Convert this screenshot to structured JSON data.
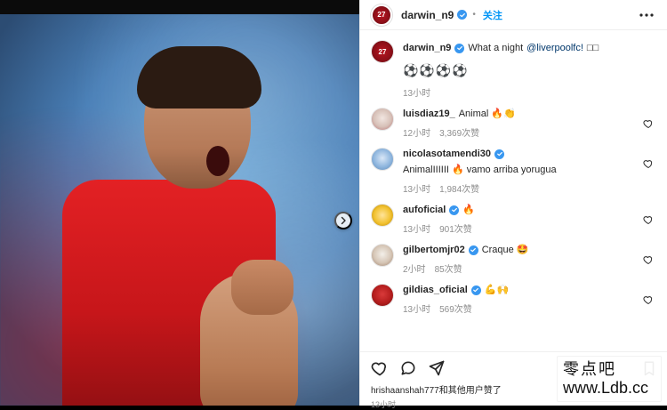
{
  "header": {
    "username": "darwin_n9",
    "follow_label": "关注"
  },
  "caption": {
    "username": "darwin_n9",
    "text_prefix": "What a night",
    "mention": "@liverpoolfc!",
    "extra": "□□",
    "balls": "⚽⚽⚽⚽",
    "time": "13小时"
  },
  "comments": [
    {
      "username": "luisdiaz19_",
      "text": "Animal 🔥👏",
      "time": "12小时",
      "likes": "3,369次赞"
    },
    {
      "username": "nicolasotamendi30",
      "text": "AnimalIIIIII 🔥 vamo arriba yorugua",
      "time": "13小时",
      "likes": "1,984次赞"
    },
    {
      "username": "aufoficial",
      "text": "🔥",
      "time": "13小时",
      "likes": "901次赞"
    },
    {
      "username": "gilbertomjr02",
      "text": "Craque 🤩",
      "time": "2小时",
      "likes": "85次赞"
    },
    {
      "username": "gildias_oficial",
      "text": "💪🙌",
      "time": "13小时",
      "likes": "569次赞"
    }
  ],
  "footer": {
    "liked_by": "hrishaanshah777和其他用户赞了",
    "time": "13小时"
  },
  "watermark": {
    "line1": "零点吧",
    "line2": "www.Ldb.cc"
  },
  "avatar_badge": "27"
}
